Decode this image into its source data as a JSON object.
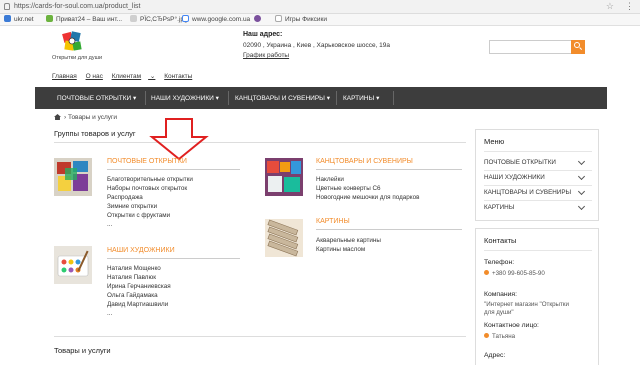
{
  "browser": {
    "url": "https://cards-for-soul.com.ua/product_list",
    "bookmarks": [
      "ukr.net",
      "Приват24 – Ваш инт...",
      "РЇС‚СЂРѕР°.jpg",
      "www.google.com.ua",
      "",
      "Игры Фиксики"
    ]
  },
  "header": {
    "logo_caption": "Открытки для души",
    "address_title": "Наш адрес:",
    "address_value": "02090 , Украина , Киев , Харьковское шоссе, 19а",
    "schedule_link": "График работы",
    "search_placeholder": ""
  },
  "toplinks": [
    "Главная",
    "О нас",
    "Клиентам",
    "Контакты"
  ],
  "nav": [
    "ПОЧТОВЫЕ ОТКРЫТКИ",
    "НАШИ ХУДОЖНИКИ",
    "КАНЦТОВАРЫ И СУВЕНИРЫ",
    "КАРТИНЫ"
  ],
  "breadcrumb": "Товары и услуги",
  "main": {
    "section_title": "Группы товаров и услуг",
    "groups": [
      {
        "title": "ПОЧТОВЫЕ ОТКРЫТКИ",
        "items": [
          "Благотворительные открытки",
          "Наборы почтовых открыток",
          "Распродажа",
          "Зимние открытки",
          "Открытки с фруктами",
          "..."
        ]
      },
      {
        "title": "КАНЦТОВАРЫ И СУВЕНИРЫ",
        "items": [
          "Наклейки",
          "Цветные конверты С6",
          "Новогодние мешочки для подарков"
        ]
      },
      {
        "title": "КАРТИНЫ",
        "items": [
          "Акварельные картины",
          "Картины маслом"
        ]
      },
      {
        "title": "НАШИ ХУДОЖНИКИ",
        "items": [
          "Наталия Мощенко",
          "Наталия Павлюк",
          "Ирина Герчаниевская",
          "Ольга Гайдамака",
          "Давид Мартиашвили",
          "..."
        ]
      }
    ],
    "bottom_title": "Товары и услуги"
  },
  "sidebar": {
    "menu_title": "Меню",
    "menu_items": [
      "ПОЧТОВЫЕ ОТКРЫТКИ",
      "НАШИ ХУДОЖНИКИ",
      "КАНЦТОВАРЫ И СУВЕНИРЫ",
      "КАРТИНЫ"
    ],
    "contacts_title": "Контакты",
    "phone_label": "Телефон:",
    "phone_value": "+380 99-605-85-90",
    "company_label": "Компания:",
    "company_value_1": "\"Интернет магазин \"Открытки",
    "company_value_2": "для души\"",
    "person_label": "Контактное лицо:",
    "person_value": "Татьяна",
    "address_label": "Адрес:"
  },
  "colors": {
    "accent": "#f28c2b",
    "nav_bg": "#3d3d3d",
    "arrow": "#e02020"
  }
}
